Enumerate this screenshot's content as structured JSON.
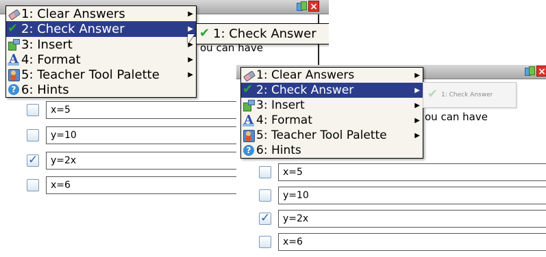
{
  "menu": {
    "items": [
      {
        "label": "1: Clear Answers",
        "icon": "eraser-icon",
        "has_submenu": true
      },
      {
        "label": "2: Check Answer",
        "icon": "check-icon",
        "has_submenu": true,
        "selected": true
      },
      {
        "label": "3: Insert",
        "icon": "insert-icon",
        "has_submenu": true
      },
      {
        "label": "4: Format",
        "icon": "format-icon",
        "has_submenu": true
      },
      {
        "label": "5: Teacher Tool Palette",
        "icon": "teacher-icon",
        "has_submenu": true
      },
      {
        "label": "6: Hints",
        "icon": "help-icon",
        "has_submenu": false
      }
    ]
  },
  "submenu_enabled": {
    "label": "1: Check Answer",
    "icon": "check-icon"
  },
  "submenu_disabled": {
    "label": "1: Check Answer",
    "icon": "check-icon",
    "state": "disabled"
  },
  "document": {
    "prompt_fragment": "ou can have",
    "options": [
      {
        "text": "x=5",
        "checked": false
      },
      {
        "text": "y=10",
        "checked": false
      },
      {
        "text": "y=2x",
        "checked": true
      },
      {
        "text": "x=6",
        "checked": false
      }
    ]
  },
  "colors": {
    "menu_background": "#f6f4ec",
    "selected_highlight": "#2b3d8a",
    "close_button": "#d9322b",
    "check_green": "#2aa339"
  }
}
